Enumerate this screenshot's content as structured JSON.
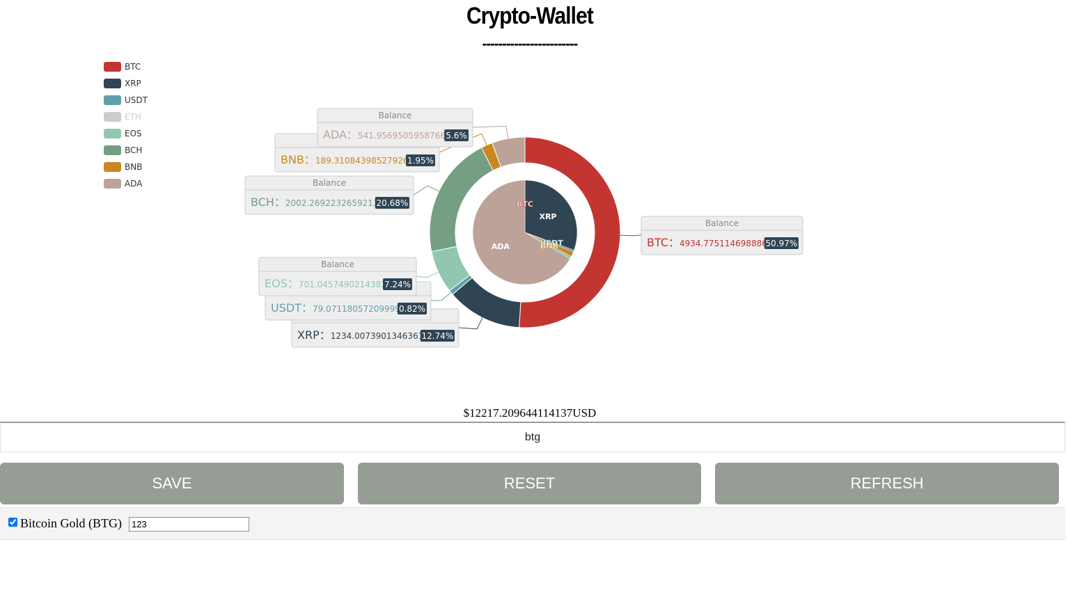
{
  "header": {
    "title": "Crypto-Wallet",
    "subtitle": "------------------------"
  },
  "chart_data": {
    "type": "pie",
    "variant": "nested donut",
    "legend_position": "top-left",
    "tooltip_title": "Balance",
    "separator": "：",
    "series": [
      {
        "name": "BTC",
        "value": 4934.775114698886,
        "percent": "50.97%",
        "color": "#c23531",
        "visible": true
      },
      {
        "name": "XRP",
        "value": 1234.0073901346361,
        "percent": "12.74%",
        "color": "#2f4554",
        "visible": true
      },
      {
        "name": "USDT",
        "value": 79.07118057209999,
        "percent": "0.82%",
        "color": "#61a0a8",
        "visible": true
      },
      {
        "name": "ETH",
        "value": 0,
        "percent": "",
        "color": "#cccccc",
        "visible": false
      },
      {
        "name": "EOS",
        "value": 701.0457490214382,
        "percent": "7.24%",
        "color": "#91c7ae",
        "visible": true
      },
      {
        "name": "BCH",
        "value": 2002.2692232659213,
        "percent": "20.68%",
        "color": "#749f83",
        "visible": true
      },
      {
        "name": "BNB",
        "value": 189.31084398527926,
        "percent": "1.95%",
        "color": "#ca8622",
        "visible": true
      },
      {
        "name": "ADA",
        "value": 541.9569505958766,
        "percent": "5.6%",
        "color": "#bda29a",
        "visible": true
      }
    ],
    "inner_pie": [
      {
        "label": "BTC",
        "percent": 0.03,
        "color": "#c23531"
      },
      {
        "label": "XRP",
        "percent": 30.5,
        "color": "#2f4554"
      },
      {
        "label": "USDT",
        "percent": 0.6,
        "color": "#61a0a8"
      },
      {
        "label": "BNB",
        "percent": 1.5,
        "color": "#ca8622"
      },
      {
        "label": "EOS",
        "percent": 0.8,
        "color": "#91c7ae"
      },
      {
        "label": "ADA",
        "percent": 66.57,
        "color": "#bda29a"
      }
    ]
  },
  "wallet": {
    "total": "$12217.209644114137USD",
    "coin_input_value": "btg"
  },
  "buttons": {
    "save": "SAVE",
    "reset": "RESET",
    "refresh": "REFRESH"
  },
  "coin_row": {
    "label": "Bitcoin Gold (BTG)",
    "checked": true,
    "amount": "123"
  }
}
